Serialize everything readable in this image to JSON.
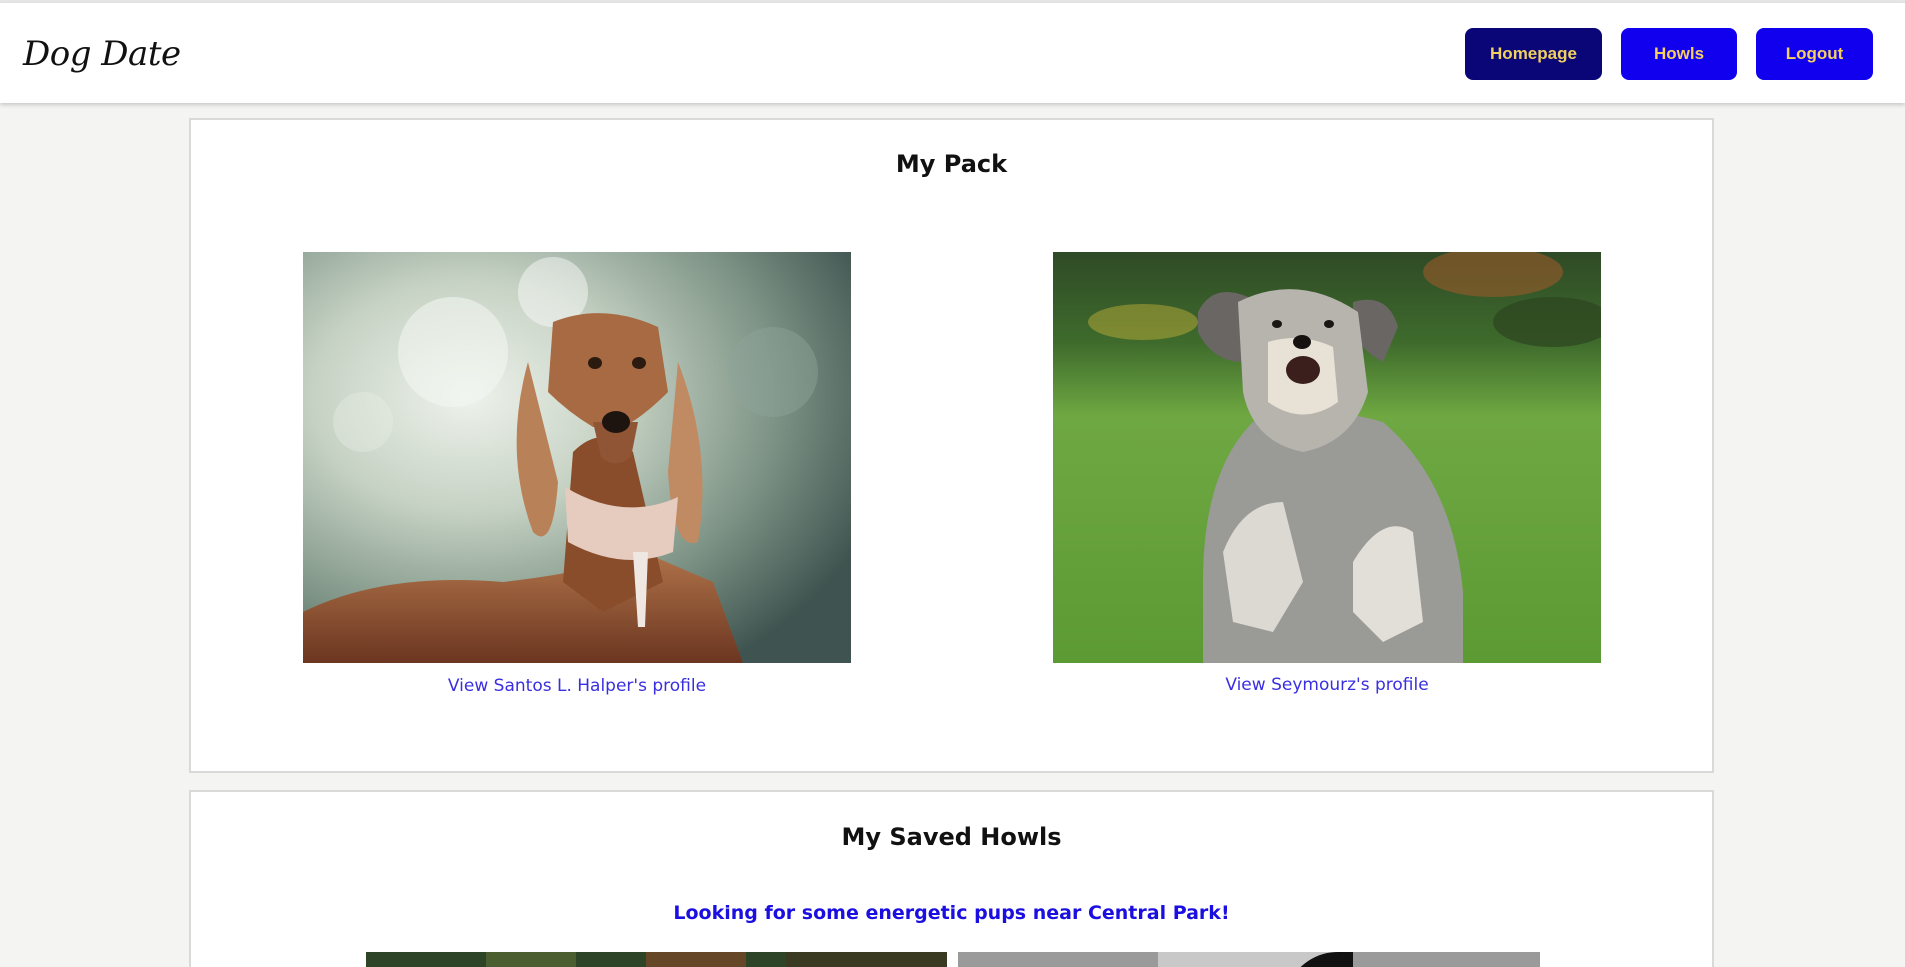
{
  "brand": {
    "name": "Dog Date"
  },
  "nav": {
    "homepage": "Homepage",
    "howls": "Howls",
    "logout": "Logout"
  },
  "pack": {
    "title": "My Pack",
    "dogs": [
      {
        "link": "View Santos L. Halper's profile",
        "photo": "saluki-photo"
      },
      {
        "link": "View Seymourz's profile",
        "photo": "schnauzer-photo"
      }
    ]
  },
  "saved_howls": {
    "title": "My Saved Howls",
    "items": [
      {
        "text": "Looking for some energetic pups near Central Park!"
      }
    ]
  },
  "colors": {
    "nav_button": "#1100ee",
    "nav_button_active": "#0b0678",
    "nav_text": "#f5d060",
    "link": "#3a2fe0"
  }
}
